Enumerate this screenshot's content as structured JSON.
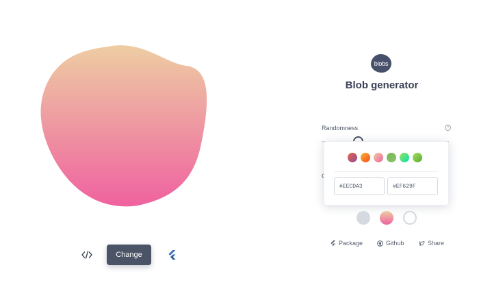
{
  "colors": {
    "gradient_start": "#EECDA3",
    "gradient_end": "#EF629F",
    "button_bg": "#4b5366",
    "title": "#3a4255"
  },
  "canvas": {
    "blob_name": "blob-shape"
  },
  "actions": {
    "code_icon": "code-icon",
    "change_label": "Change",
    "flutter_icon": "flutter-icon"
  },
  "header": {
    "logo_text": "blobs",
    "title": "Blob generator"
  },
  "controls": {
    "randomness_label": "Randomness",
    "randomness_fraction": 0.29
  },
  "color_picker": {
    "presets": [
      {
        "from": "#e96443",
        "to": "#904e95"
      },
      {
        "from": "#f7b733",
        "to": "#fc4a1a"
      },
      {
        "from": "#EECDA3",
        "to": "#EF629F"
      },
      {
        "from": "#76b852",
        "to": "#8DC26F"
      },
      {
        "from": "#9be15d",
        "to": "#00e3ae"
      },
      {
        "from": "#a8e063",
        "to": "#56ab2f"
      }
    ],
    "start_hex": "#EECDA3",
    "end_hex": "#EF629F"
  },
  "fill_modes": [
    "solid",
    "gradient",
    "outline"
  ],
  "footer": {
    "package_label": "Package",
    "github_label": "Github",
    "share_label": "Share"
  }
}
